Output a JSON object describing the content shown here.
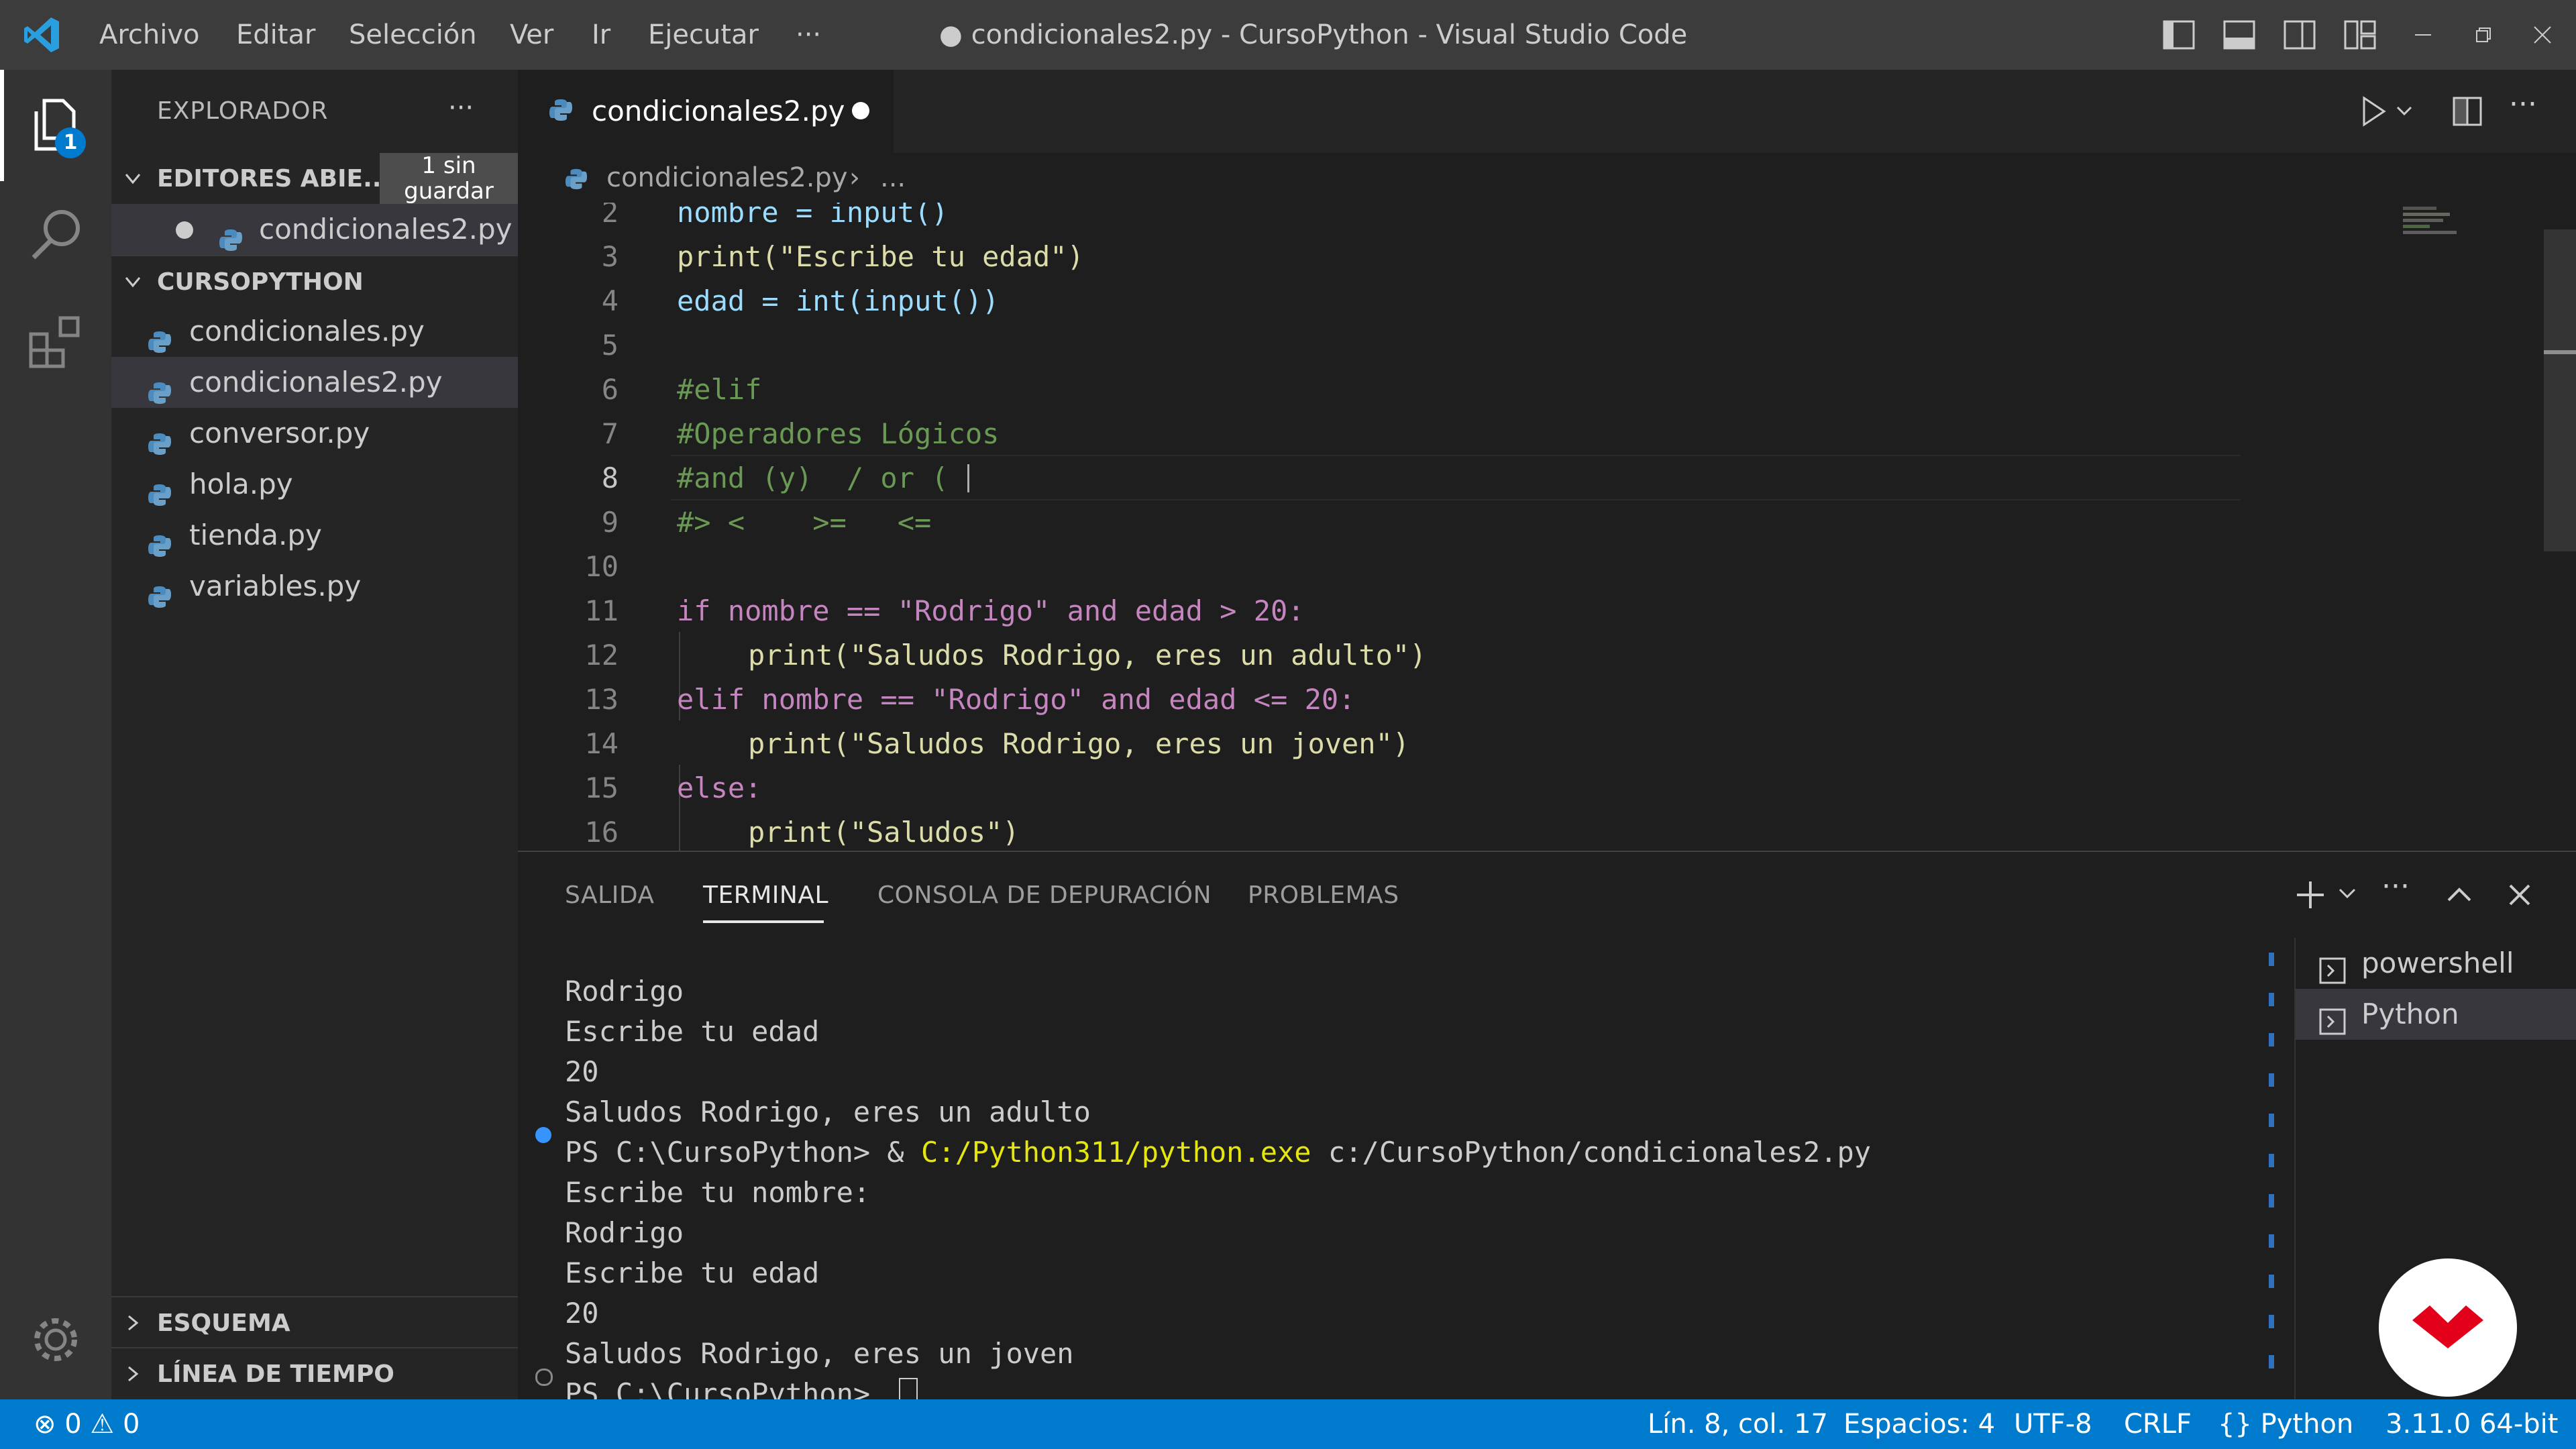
{
  "titlebar": {
    "menus": [
      "Archivo",
      "Editar",
      "Selección",
      "Ver",
      "Ir",
      "Ejecutar",
      "···"
    ],
    "window_title": "● condicionales2.py - CursoPython - Visual Studio Code"
  },
  "activitybar": {
    "explorer_badge": "1"
  },
  "sidebar": {
    "header": "EXPLORADOR",
    "more": "···",
    "open_editors": {
      "title": "EDITORES ABIE...",
      "unsaved_badge": "1 sin guardar",
      "files": [
        "condicionales2.py"
      ]
    },
    "project": {
      "title": "CURSOPYTHON",
      "files": [
        "condicionales.py",
        "condicionales2.py",
        "conversor.py",
        "hola.py",
        "tienda.py",
        "variables.py"
      ]
    },
    "outline": "ESQUEMA",
    "timeline": "LÍNEA DE TIEMPO"
  },
  "tabs": {
    "active": "condicionales2.py"
  },
  "breadcrumb": {
    "file": "condicionales2.py",
    "rest": "..."
  },
  "editor": {
    "line_numbers": [
      "2",
      "3",
      "4",
      "5",
      "6",
      "7",
      "8",
      "9",
      "10",
      "11",
      "12",
      "13",
      "14",
      "15",
      "16"
    ],
    "lines": {
      "l2": "nombre = input()",
      "l3": "print(\"Escribe tu edad\")",
      "l4": "edad = int(input())",
      "l6": "#elif",
      "l7": "#Operadores Lógicos",
      "l8": "#and (y)  / or (",
      "l9": "#> <    >=   <=",
      "l11": "if nombre == \"Rodrigo\" and edad > 20:",
      "l12": "print(\"Saludos Rodrigo, eres un adulto\")",
      "l13": "elif nombre == \"Rodrigo\" and edad <= 20:",
      "l14": "print(\"Saludos Rodrigo, eres un joven\")",
      "l15": "else:",
      "l16": "print(\"Saludos\")"
    }
  },
  "panel": {
    "tabs": [
      "SALIDA",
      "TERMINAL",
      "CONSOLA DE DEPURACIÓN",
      "PROBLEMAS"
    ],
    "active_tab": "TERMINAL",
    "terminal_lines": [
      "Rodrigo",
      "Escribe tu edad",
      "20",
      "Saludos Rodrigo, eres un adulto",
      "PS C:\\CursoPython> & C:/Python311/python.exe c:/CursoPython/condicionales2.py",
      "Escribe tu nombre:",
      "Rodrigo",
      "Escribe tu edad",
      "20",
      "Saludos Rodrigo, eres un joven",
      "PS C:\\CursoPython> "
    ],
    "cmd_prompt": "PS C:\\CursoPython> & ",
    "cmd_exe": "C:/Python311/python.exe",
    "cmd_arg": " c:/CursoPython/condicionales2.py",
    "terminals": [
      "powershell",
      "Python"
    ]
  },
  "statusbar": {
    "errors": "0",
    "warnings": "0",
    "position": "Lín. 8, col. 17",
    "spaces": "Espacios: 4",
    "encoding": "UTF-8",
    "eol": "CRLF",
    "language": "Python",
    "interpreter": "3.11.0 64-bit"
  },
  "colors": {
    "accent": "#007acc",
    "titlebar": "#3c3c3c",
    "sidebar": "#252526",
    "editor": "#1e1e1e",
    "brand_logo": "#e2001a"
  }
}
